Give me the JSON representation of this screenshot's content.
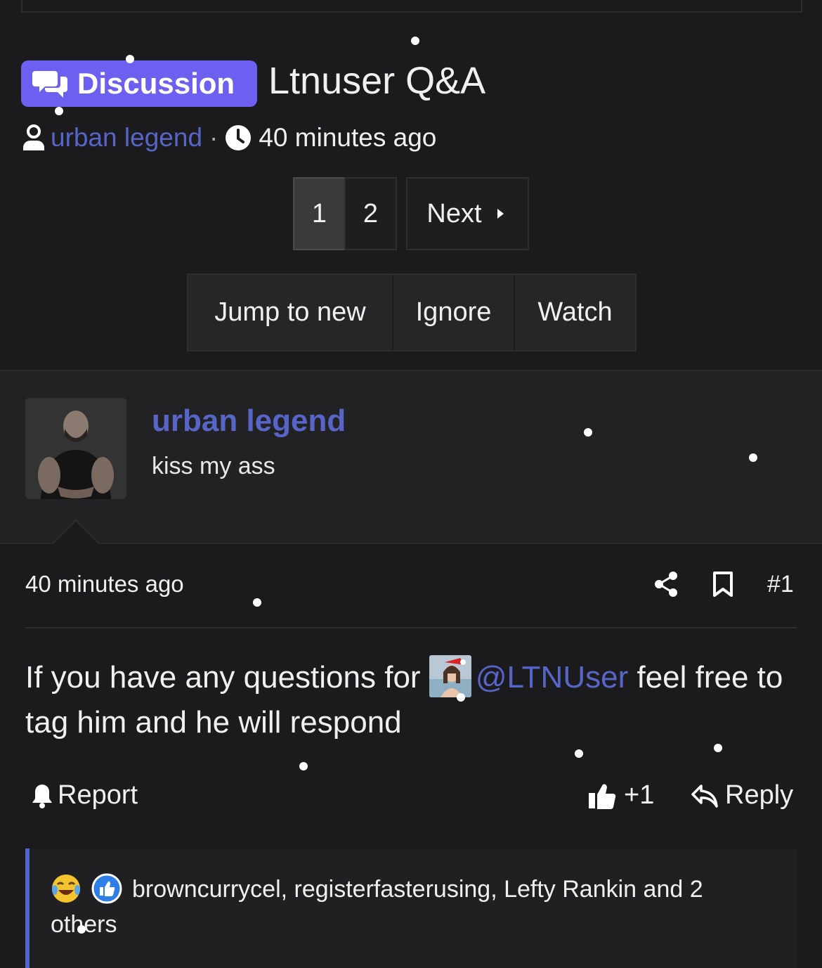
{
  "thread": {
    "prefix_label": "Discussion",
    "title": "Ltnuser Q&A",
    "author": "urban legend",
    "separator": "·",
    "time": "40 minutes ago"
  },
  "pagination": {
    "pages": [
      "1",
      "2"
    ],
    "current": "1",
    "next_label": "Next"
  },
  "actions": {
    "jump_label": "Jump to new",
    "ignore_label": "Ignore",
    "watch_label": "Watch"
  },
  "post": {
    "username": "urban legend",
    "user_title": "kiss my ass",
    "time": "40 minutes ago",
    "number": "#1",
    "body_before": "If you have any questions for",
    "mention": "@LTNUser",
    "body_after": "feel free to tag him and he will respond",
    "report_label": "Report",
    "like_label": "+1",
    "reply_label": "Reply",
    "reactions_text": "browncurrycel, registerfasterusing, Lefty Rankin and 2 others"
  },
  "colors": {
    "accent": "#5865c8",
    "badge": "#6d5ff0",
    "background": "#1b1b1d"
  },
  "icons": [
    "comments-icon",
    "user-icon",
    "clock-icon",
    "caret-right-icon",
    "share-icon",
    "bookmark-icon",
    "bell-icon",
    "thumbs-up-icon",
    "reply-icon",
    "laugh-cry-emoji",
    "like-emoji"
  ]
}
